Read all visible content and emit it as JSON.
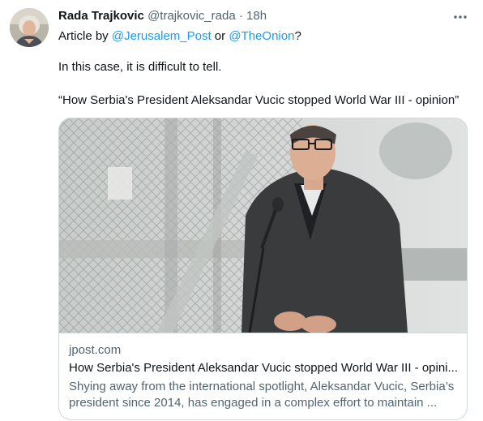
{
  "tweet": {
    "author": {
      "display_name": "Rada Trajkovic",
      "handle": "@trajkovic_rada",
      "separator": "·",
      "time": "18h",
      "avatar_icon": "avatar-photo"
    },
    "more_icon": "more-horizontal-icon",
    "text": {
      "line1_prefix": "Article by ",
      "mention1": "@Jerusalem_Post",
      "line1_middle": " or ",
      "mention2": "@TheOnion",
      "line1_suffix": "?",
      "line2": "In this case, it is difficult to tell.",
      "line3": "“How Serbia's President Aleksandar Vucic stopped World War III - opinion”"
    },
    "card": {
      "domain": "jpost.com",
      "title": "How Serbia's President Aleksandar Vucic stopped World War III - opini...",
      "description_line1": "Shying away from the international spotlight, Aleksandar Vucic, Serbia’s",
      "description_line2": "president since 2014, has engaged in a complex effort to maintain ..."
    },
    "colors": {
      "text": "#0f1419",
      "secondary": "#536471",
      "link": "#1d9bf0",
      "border": "#cfd9de"
    }
  }
}
